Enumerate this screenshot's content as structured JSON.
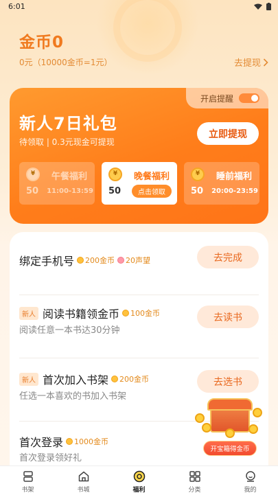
{
  "status_bar": {
    "time": "6:01"
  },
  "header": {
    "coin_title": "金币0",
    "coin_sub": "0元（10000金币=1元）",
    "withdraw_link": "去提现"
  },
  "gift": {
    "reminder_label": "开启提醒",
    "title": "新人7日礼包",
    "subtitle": "待领取 | 0.3元现金可提现",
    "button": "立即提现",
    "slots": [
      {
        "name": "午餐福利",
        "amount": "50",
        "time": "11:00-13:59",
        "state": "expired"
      },
      {
        "name": "晚餐福利",
        "amount": "50",
        "claim": "点击领取",
        "state": "active"
      },
      {
        "name": "睡前福利",
        "amount": "50",
        "time": "20:00-23:59",
        "state": "upcoming"
      }
    ]
  },
  "tasks": [
    {
      "title": "绑定手机号",
      "reward1": "200金币",
      "reward2": "20声望",
      "button": "去完成"
    },
    {
      "tag": "新人",
      "title": "阅读书籍领金币",
      "reward1": "100金币",
      "desc": "阅读任意一本书达30分钟",
      "button": "去读书"
    },
    {
      "tag": "新人",
      "title": "首次加入书架",
      "reward1": "200金币",
      "desc": "任选一本喜欢的书加入书架",
      "button": "去选书"
    },
    {
      "title": "首次登录",
      "reward1": "1000金币",
      "desc": "首次登录领好礼"
    }
  ],
  "treasure": {
    "label": "开宝箱得金币"
  },
  "tabbar": [
    {
      "label": "书架",
      "icon": "bookshelf-icon"
    },
    {
      "label": "书城",
      "icon": "home-icon"
    },
    {
      "label": "福利",
      "icon": "welfare-coin-icon",
      "active": true
    },
    {
      "label": "分类",
      "icon": "grid-icon"
    },
    {
      "label": "我的",
      "icon": "profile-icon"
    }
  ],
  "colors": {
    "accent": "#ff7d1a",
    "coin_text": "#f07a1f",
    "button_bg": "#ffe9d9"
  }
}
